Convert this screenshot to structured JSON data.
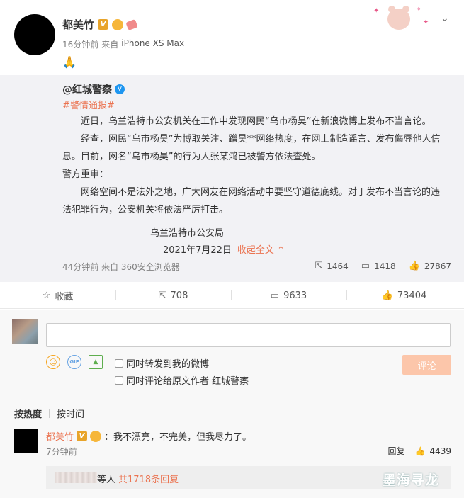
{
  "post": {
    "username": "都美竹",
    "vip_badge": "V",
    "time": "16分钟前",
    "source_prefix": "来自",
    "device": "iPhone XS Max",
    "content_emoji": "🙏"
  },
  "repost": {
    "author": "@红城警察",
    "hashtag": "#警情通报#",
    "paragraphs": [
      "近日，乌兰浩特市公安机关在工作中发现网民“乌市杨昊”在新浪微博上发布不当言论。",
      "经查，网民“乌市杨昊”为博取关注、蹭昊**网络热度，在网上制造谣言、发布侮辱他人信息。目前，网名“乌市杨昊”的行为人张某鸿已被警方依法查处。",
      "警方重申：",
      "网络空间不是法外之地，广大网友在网络活动中要坚守道德底线。对于发布不当言论的违法犯罪行为，公安机关将依法严厉打击。"
    ],
    "signature": "乌兰浩特市公安局",
    "date": "2021年7月22日",
    "collapse_label": "收起全文 ⌃",
    "meta": "44分钟前 来自 360安全浏览器",
    "stats": {
      "forward": "1464",
      "comment": "1418",
      "like": "27867"
    }
  },
  "actions": {
    "favorite": "收藏",
    "forward": "708",
    "comment": "9633",
    "like": "73404"
  },
  "composer": {
    "repost_option": "同时转发到我的微博",
    "comment_option": "同时评论给原文作者 红城警察",
    "submit_label": "评论"
  },
  "sort": {
    "hot": "按热度",
    "time": "按时间"
  },
  "comment": {
    "user": "都美竹",
    "text": "：我不漂亮，不完美，但我尽力了。",
    "time": "7分钟前",
    "reply_label": "回复",
    "likes": "4439",
    "replies_prefix": "等人",
    "replies_count": "共1718条回复"
  },
  "watermark": "墨海寻龙"
}
